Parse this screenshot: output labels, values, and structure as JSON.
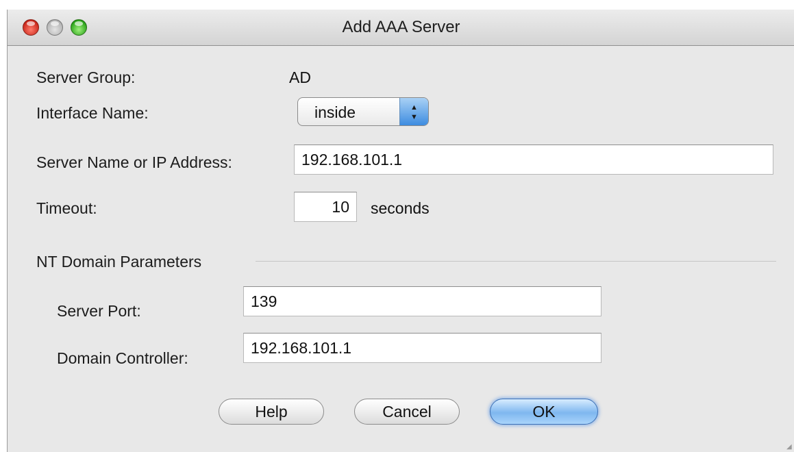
{
  "window": {
    "title": "Add AAA Server"
  },
  "form": {
    "server_group_label": "Server Group:",
    "server_group_value": "AD",
    "interface_label": "Interface Name:",
    "interface_value": "inside",
    "server_name_label": "Server Name or IP Address:",
    "server_name_value": "192.168.101.1",
    "timeout_label": "Timeout:",
    "timeout_value": "10",
    "timeout_unit": "seconds"
  },
  "nt_domain": {
    "section_label": "NT Domain Parameters",
    "server_port_label": "Server Port:",
    "server_port_value": "139",
    "domain_controller_label": "Domain Controller:",
    "domain_controller_value": "192.168.101.1"
  },
  "buttons": {
    "help": "Help",
    "cancel": "Cancel",
    "ok": "OK"
  },
  "colors": {
    "window_bg": "#e8e8e8",
    "default_button": "#7fb7ef",
    "close_light": "#c9271b",
    "zoom_light": "#2ba31a"
  },
  "icons": {
    "popup_arrows": "up-down-arrows-icon",
    "resize_grip": "resize-grip-icon"
  }
}
